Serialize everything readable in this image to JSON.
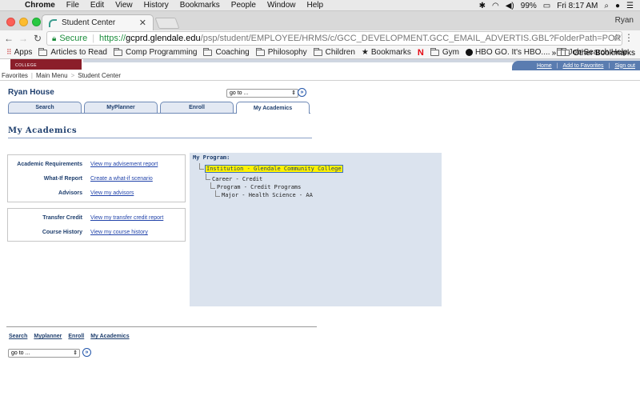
{
  "macos": {
    "app_name": "Chrome",
    "menus": [
      "File",
      "Edit",
      "View",
      "History",
      "Bookmarks",
      "People",
      "Window",
      "Help"
    ],
    "battery": "99%",
    "clock": "Fri 8:17 AM"
  },
  "browser": {
    "tab_title": "Student Center",
    "profile_name": "Ryan",
    "secure_label": "Secure",
    "url_scheme": "https://",
    "url_host": "gcprd.glendale.edu",
    "url_path": "/psp/student/EMPLOYEE/HRMS/c/GCC_DEVELOPMENT.GCC_EMAIL_ADVERTIS.GBL?FolderPath=PORTAL_ROOT_OBJECT.GCC_EMAI...",
    "bookmarks": [
      {
        "label": "Apps",
        "icon": "apps-grid-icon"
      },
      {
        "label": "Articles to Read",
        "icon": "folder-icon"
      },
      {
        "label": "Comp Programming",
        "icon": "folder-icon"
      },
      {
        "label": "Coaching",
        "icon": "folder-icon"
      },
      {
        "label": "Philosophy",
        "icon": "folder-icon"
      },
      {
        "label": "Children",
        "icon": "folder-icon"
      },
      {
        "label": "Bookmarks",
        "icon": "star-icon"
      },
      {
        "label": "",
        "icon": "netflix-icon"
      },
      {
        "label": "Gym",
        "icon": "folder-icon"
      },
      {
        "label": "HBO GO. It's HBO....",
        "icon": "hbo-icon"
      },
      {
        "label": "Job Search Help",
        "icon": "folder-icon"
      }
    ],
    "overflow": "»",
    "other_bookmarks": "Other Bookmarks"
  },
  "site": {
    "logo_text": "COLLEGE",
    "top_links": [
      "Home",
      "Add to Favorites",
      "Sign out"
    ],
    "breadcrumb": [
      "Favorites",
      "Main Menu",
      "Student Center"
    ]
  },
  "student": {
    "name": "Ryan House",
    "goto_label": "go to ...",
    "tabs": [
      "Search",
      "MyPlanner",
      "Enroll",
      "My Academics"
    ],
    "active_tab": "My Academics",
    "section_title": "My Academics"
  },
  "panel1": [
    {
      "label": "Academic Requirements",
      "link": "View my advisement report"
    },
    {
      "label": "What-If Report",
      "link": "Create a what-if scenario"
    },
    {
      "label": "Advisors",
      "link": "View my advisors"
    }
  ],
  "panel2": [
    {
      "label": "Transfer Credit",
      "link": "View my transfer credit report"
    },
    {
      "label": "Course History",
      "link": "View my course history"
    }
  ],
  "program": {
    "title": "My Program:",
    "institution": "Institution - Glendale Community College",
    "career": "Career - Credit",
    "program": "Program - Credit Programs",
    "major": "Major - Health Science - AA"
  },
  "footer": {
    "links": [
      "Search",
      "Myplanner",
      "Enroll",
      "My Academics"
    ],
    "goto_label": "go to ..."
  },
  "colors": {
    "brand_navy": "#1f3f6e",
    "link_blue": "#2244aa",
    "college_maroon": "#8b1e2a",
    "program_bg": "#dbe3ee",
    "highlight": "#fff200"
  }
}
